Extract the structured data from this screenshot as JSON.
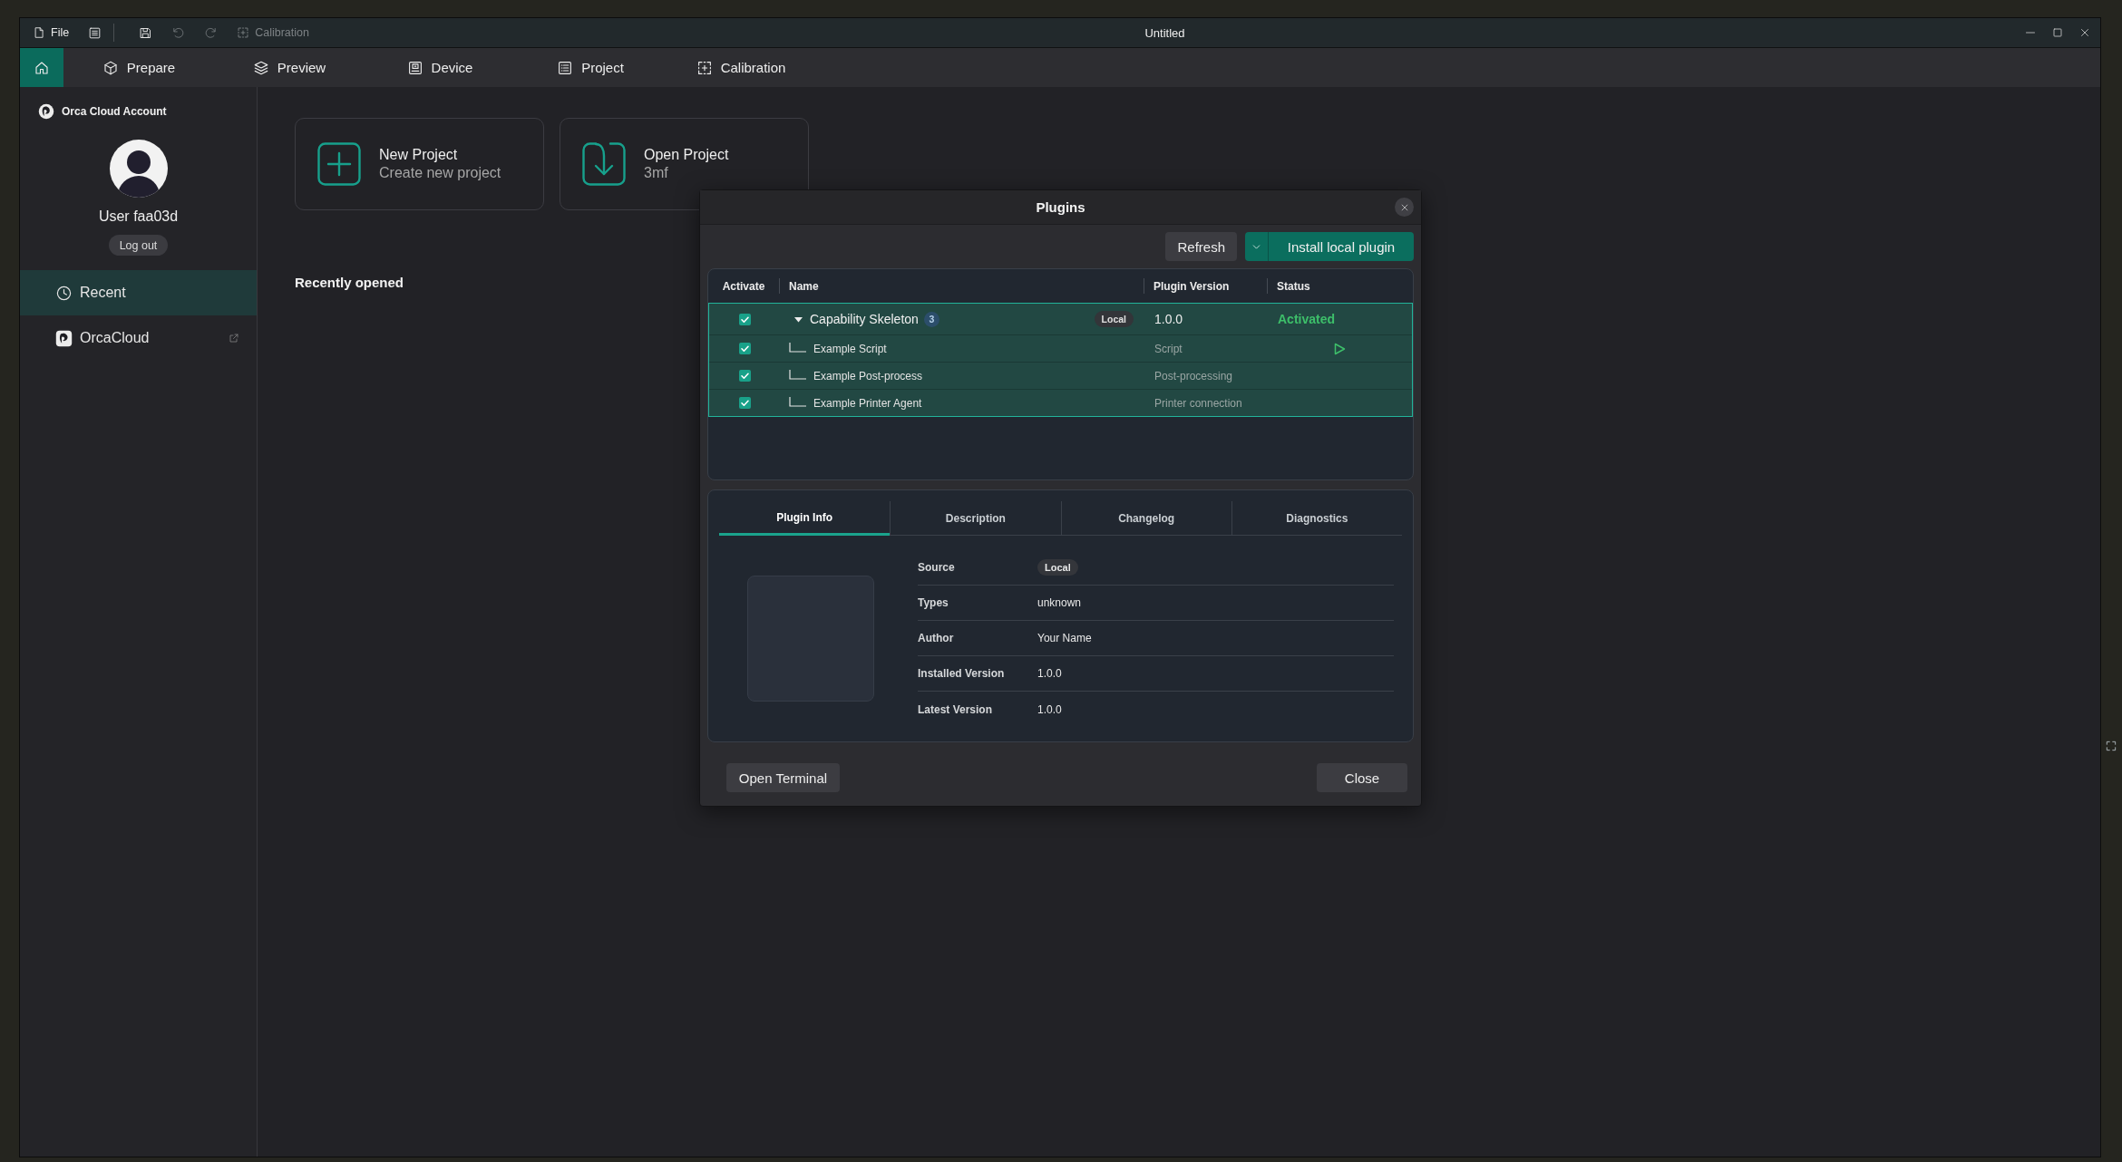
{
  "title_bar": {
    "tools": [
      {
        "kind": "file",
        "label": "File",
        "disabled": false
      },
      {
        "kind": "menu",
        "disabled": false
      },
      {
        "kind": "save",
        "disabled": false
      },
      {
        "kind": "undo",
        "disabled": true
      },
      {
        "kind": "redo",
        "disabled": true
      },
      {
        "kind": "calibration",
        "label": "Calibration",
        "disabled": true
      }
    ],
    "title": "Untitled"
  },
  "nav_tabs": [
    {
      "kind": "home",
      "selected": true
    },
    {
      "kind": "prepare",
      "label": "Prepare",
      "selected": false
    },
    {
      "kind": "preview",
      "label": "Preview",
      "selected": false
    },
    {
      "kind": "device",
      "label": "Device",
      "selected": false
    },
    {
      "kind": "project",
      "label": "Project",
      "selected": false
    },
    {
      "kind": "calibration",
      "label": "Calibration",
      "selected": false
    }
  ],
  "sidebar": {
    "account_title": "Orca Cloud Account",
    "user_name": "User faa03d",
    "logout_button": "Log out",
    "items": [
      {
        "kind": "recent",
        "label": "Recent",
        "selected": true
      },
      {
        "kind": "cloud",
        "label": "OrcaCloud",
        "selected": false
      }
    ]
  },
  "home": {
    "cards": [
      {
        "kind": "new",
        "title": "New Project",
        "subtitle": "Create new project"
      },
      {
        "kind": "open",
        "title": "Open Project",
        "subtitle": "3mf"
      }
    ],
    "recent_heading": "Recently opened"
  },
  "plugins_dialog": {
    "title": "Plugins",
    "refresh_button": "Refresh",
    "install_button": "Install local plugin",
    "table": {
      "columns": [
        "Activate",
        "Name",
        "Plugin Version",
        "Status"
      ],
      "rows": [
        {
          "name": "Capability Skeleton",
          "count": "3",
          "source": "Local",
          "version": "1.0.0",
          "status": "Activated",
          "checked": true,
          "expanded": true,
          "selected": true,
          "children": [
            {
              "kind": "script",
              "name": "Example Script",
              "type": "Script",
              "checked": true
            },
            {
              "kind": "post-process",
              "name": "Example Post-process",
              "type": "Post-processing",
              "checked": true
            },
            {
              "kind": "printer-agent",
              "name": "Example Printer Agent",
              "type": "Printer connection",
              "checked": true
            }
          ]
        }
      ]
    },
    "detail_tabs": [
      {
        "label": "Plugin Info",
        "selected": true
      },
      {
        "label": "Description",
        "selected": false
      },
      {
        "label": "Changelog",
        "selected": false
      },
      {
        "label": "Diagnostics",
        "selected": false
      }
    ],
    "info": [
      {
        "kind": "badge",
        "label": "Source",
        "value": "Local"
      },
      {
        "kind": "text",
        "label": "Types",
        "value": "unknown"
      },
      {
        "kind": "text",
        "label": "Author",
        "value": "Your Name"
      },
      {
        "kind": "text",
        "label": "Installed Version",
        "value": "1.0.0"
      },
      {
        "kind": "text",
        "label": "Latest Version",
        "value": "1.0.0"
      }
    ],
    "open_terminal_button": "Open Terminal",
    "close_button": "Close"
  }
}
